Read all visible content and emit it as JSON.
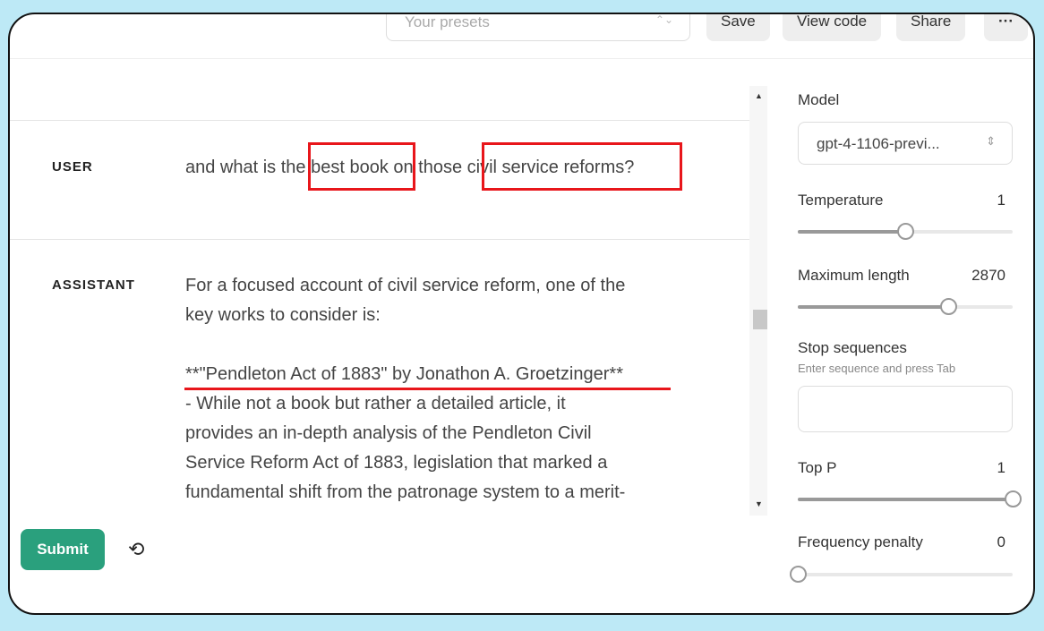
{
  "header": {
    "presets_placeholder": "Your presets",
    "save": "Save",
    "view_code": "View code",
    "share": "Share",
    "more": "···"
  },
  "messages": [
    {
      "role": "USER",
      "text": "and what is the best book on those civil service reforms?"
    },
    {
      "role": "ASSISTANT",
      "lines": [
        "For a focused account of civil service reform, one of the",
        "key works to consider is:",
        "",
        "**\"Pendleton Act of 1883\" by Jonathon A. Groetzinger**",
        "- While not a book but rather a detailed article, it",
        "provides an in-depth analysis of the Pendleton Civil",
        "Service Reform Act of 1883, legislation that marked a",
        "fundamental shift from the patronage system to a merit-"
      ]
    }
  ],
  "footer": {
    "submit": "Submit",
    "history_icon": "history-icon"
  },
  "settings": {
    "model_label": "Model",
    "model_value": "gpt-4-1106-previ...",
    "temperature": {
      "label": "Temperature",
      "value": "1",
      "fraction": 0.5
    },
    "max_length": {
      "label": "Maximum length",
      "value": "2870",
      "fraction": 0.7
    },
    "stop": {
      "label": "Stop sequences",
      "hint": "Enter sequence and press Tab"
    },
    "top_p": {
      "label": "Top P",
      "value": "1",
      "fraction": 1.0
    },
    "freq": {
      "label": "Frequency penalty",
      "value": "0",
      "fraction": 0.0
    }
  },
  "annotation_color": "#e8161b",
  "accent": "#2aa07d"
}
